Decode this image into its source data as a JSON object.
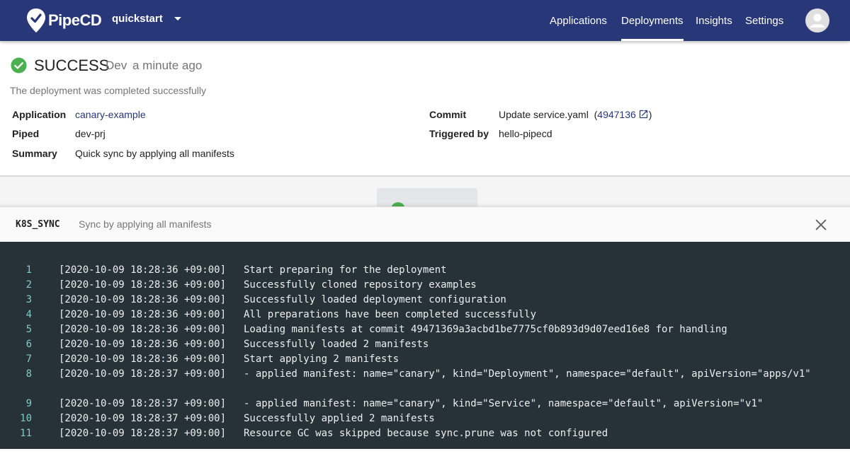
{
  "header": {
    "logo_text": "PipeCD",
    "project": "quickstart",
    "nav": [
      "Applications",
      "Deployments",
      "Insights",
      "Settings"
    ],
    "active_nav": "Deployments",
    "brand_color": "#283778"
  },
  "deployment": {
    "status": "SUCCESS",
    "env": "Dev",
    "time": "a minute ago",
    "status_reason": "The deployment was completed successfully",
    "fields": {
      "application_label": "Application",
      "application": "canary-example",
      "piped_label": "Piped",
      "piped": "dev-prj",
      "summary_label": "Summary",
      "summary": "Quick sync by applying all manifests",
      "commit_label": "Commit",
      "commit_message": "Update service.yaml",
      "commit_hash": "4947136",
      "triggered_by_label": "Triggered by",
      "triggered_by": "hello-pipecd"
    },
    "success_color": "#4caf50"
  },
  "stage": {
    "name": "K8S_SYNC",
    "description": "Sync by applying all manifests"
  },
  "logs": [
    {
      "n": "1",
      "time": "[2020-10-09 18:28:36 +09:00]",
      "msg": "Start preparing for the deployment"
    },
    {
      "n": "2",
      "time": "[2020-10-09 18:28:36 +09:00]",
      "msg": "Successfully cloned repository examples"
    },
    {
      "n": "3",
      "time": "[2020-10-09 18:28:36 +09:00]",
      "msg": "Successfully loaded deployment configuration"
    },
    {
      "n": "4",
      "time": "[2020-10-09 18:28:36 +09:00]",
      "msg": "All preparations have been completed successfully"
    },
    {
      "n": "5",
      "time": "[2020-10-09 18:28:36 +09:00]",
      "msg": "Loading manifests at commit 49471369a3acbd1be7775cf0b893d9d07eed16e8 for handling"
    },
    {
      "n": "6",
      "time": "[2020-10-09 18:28:36 +09:00]",
      "msg": "Successfully loaded 2 manifests"
    },
    {
      "n": "7",
      "time": "[2020-10-09 18:28:36 +09:00]",
      "msg": "Start applying 2 manifests"
    },
    {
      "n": "8",
      "time": "[2020-10-09 18:28:37 +09:00]",
      "msg": "- applied manifest: name=\"canary\", kind=\"Deployment\", namespace=\"default\", apiVersion=\"apps/v1\""
    },
    {
      "n": "9",
      "time": "[2020-10-09 18:28:37 +09:00]",
      "msg": "- applied manifest: name=\"canary\", kind=\"Service\", namespace=\"default\", apiVersion=\"v1\""
    },
    {
      "n": "10",
      "time": "[2020-10-09 18:28:37 +09:00]",
      "msg": "Successfully applied 2 manifests"
    },
    {
      "n": "11",
      "time": "[2020-10-09 18:28:37 +09:00]",
      "msg": "Resource GC was skipped because sync.prune was not configured"
    }
  ]
}
